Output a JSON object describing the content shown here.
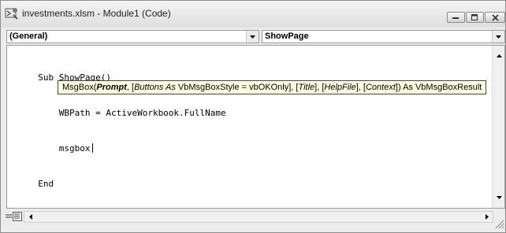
{
  "window": {
    "title": "investments.xlsm - Module1 (Code)",
    "icon": "vba-module-icon"
  },
  "combos": {
    "object": "(General)",
    "procedure": "ShowPage"
  },
  "code": {
    "lines": [
      "  Sub ShowPage()",
      "      WBPath = ActiveWorkbook.FullName",
      "      msgbox",
      "  End"
    ]
  },
  "tooltip": {
    "prefix": "MsgBox(",
    "prompt": "Prompt",
    "rest_1": ", [",
    "buttons": "Buttons As",
    "rest_2": " VbMsgBoxStyle = vbOKOnly], [",
    "title": "Title",
    "rest_3": "], [",
    "helpfile": "HelpFile",
    "rest_4": "], [",
    "context": "Context",
    "rest_5": "]) As VbMsgBoxResult"
  }
}
